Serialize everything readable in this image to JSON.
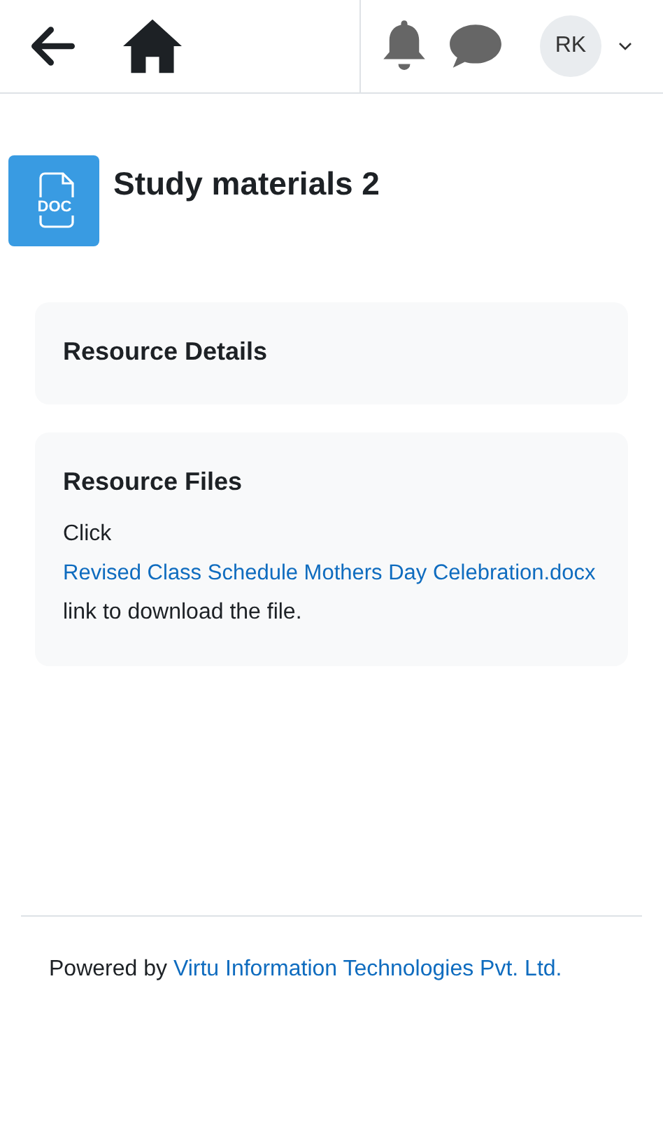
{
  "header": {
    "avatar_initials": "RK"
  },
  "page": {
    "icon_label": "DOC",
    "title": "Study materials 2"
  },
  "sections": [
    {
      "heading": "Resource Details"
    },
    {
      "heading": "Resource Files",
      "text_before": "Click",
      "link": "Revised Class Schedule Mothers Day Celebration.docx",
      "text_after": "link to download the file."
    }
  ],
  "footer": {
    "text": "Powered by",
    "link": "Virtu Information Technologies Pvt. Ltd."
  }
}
